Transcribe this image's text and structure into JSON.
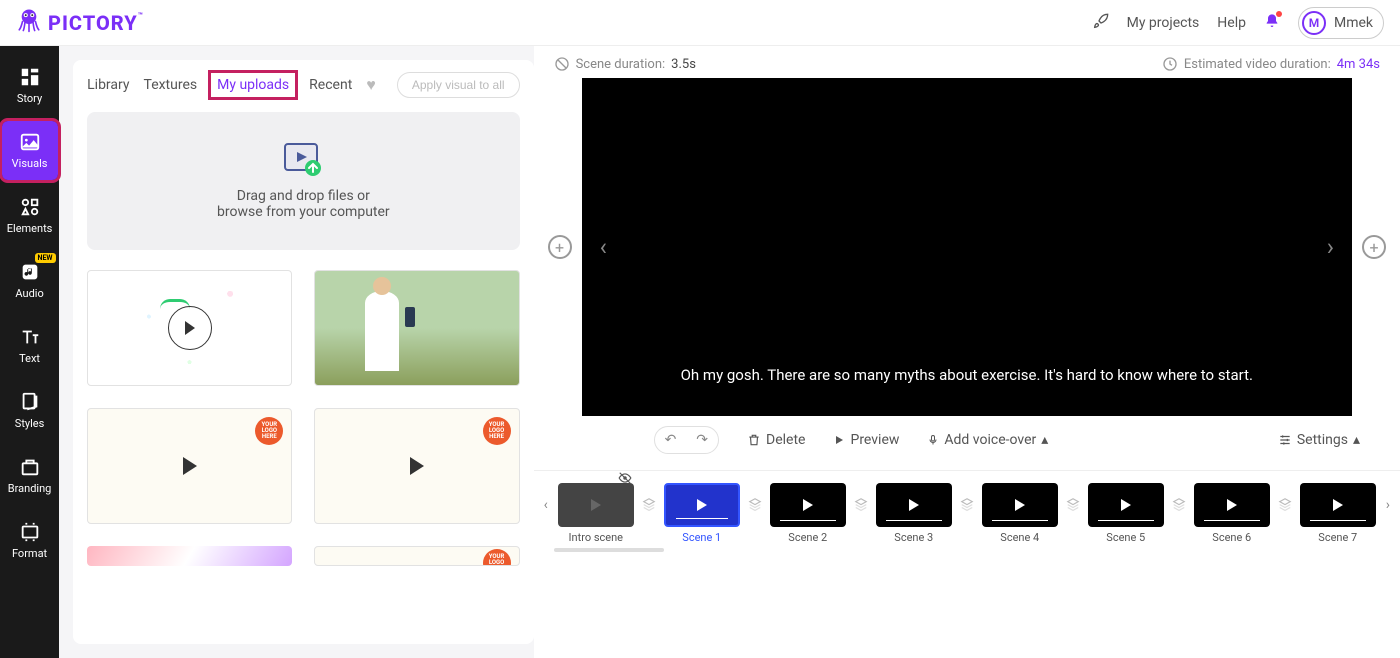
{
  "header": {
    "brand": "PICTORY",
    "upgrade_icon": "rocket",
    "my_projects": "My projects",
    "help": "Help",
    "user_initial": "M",
    "user_name": "Mmek"
  },
  "sidebar": {
    "items": [
      {
        "label": "Story",
        "icon": "story"
      },
      {
        "label": "Visuals",
        "icon": "visuals",
        "active": true,
        "highlighted": true
      },
      {
        "label": "Elements",
        "icon": "elements"
      },
      {
        "label": "Audio",
        "icon": "audio",
        "badge": "NEW"
      },
      {
        "label": "Text",
        "icon": "text"
      },
      {
        "label": "Styles",
        "icon": "styles"
      },
      {
        "label": "Branding",
        "icon": "branding"
      },
      {
        "label": "Format",
        "icon": "format"
      }
    ]
  },
  "visuals": {
    "tabs": [
      {
        "label": "Library"
      },
      {
        "label": "Textures"
      },
      {
        "label": "My uploads",
        "active": true,
        "highlighted": true
      },
      {
        "label": "Recent"
      }
    ],
    "apply_all": "Apply visual to all",
    "dropzone_line1": "Drag and drop files or",
    "dropzone_line2": "browse from your computer",
    "logo_badge_text": "YOUR LOGO HERE"
  },
  "preview": {
    "scene_duration_label": "Scene duration:",
    "scene_duration_value": "3.5s",
    "estimated_label": "Estimated video duration:",
    "estimated_value": "4m 34s",
    "caption": "Oh my gosh. There are so many myths about exercise. It's hard to know where to start.",
    "toolbar": {
      "delete": "Delete",
      "preview": "Preview",
      "voiceover": "Add voice-over",
      "settings": "Settings"
    }
  },
  "timeline": {
    "scenes": [
      {
        "label": "Intro scene",
        "intro": true,
        "eye_off": true
      },
      {
        "label": "Scene 1",
        "selected": true
      },
      {
        "label": "Scene 2"
      },
      {
        "label": "Scene 3"
      },
      {
        "label": "Scene 4"
      },
      {
        "label": "Scene 5"
      },
      {
        "label": "Scene 6"
      },
      {
        "label": "Scene 7"
      }
    ]
  }
}
